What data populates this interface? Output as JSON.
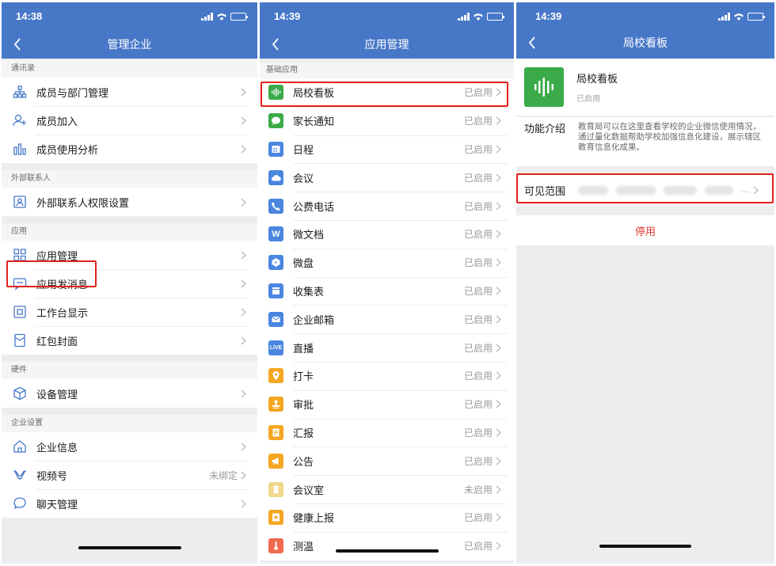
{
  "colors": {
    "header": "#4778c8",
    "highlight": "#e2211c",
    "danger": "#e53935"
  },
  "panel1": {
    "time": "14:38",
    "title": "管理企业",
    "sections": [
      {
        "title": "通讯录",
        "items": [
          {
            "label": "成员与部门管理",
            "icon": "org-chart-icon"
          },
          {
            "label": "成员加入",
            "icon": "user-add-icon"
          },
          {
            "label": "成员使用分析",
            "icon": "bar-chart-icon"
          }
        ]
      },
      {
        "title": "外部联系人",
        "items": [
          {
            "label": "外部联系人权限设置",
            "icon": "contact-card-icon"
          }
        ]
      },
      {
        "title": "应用",
        "items": [
          {
            "label": "应用管理",
            "icon": "grid-icon"
          },
          {
            "label": "应用发消息",
            "icon": "message-icon"
          },
          {
            "label": "工作台显示",
            "icon": "workbench-icon"
          },
          {
            "label": "红包封面",
            "icon": "red-packet-icon"
          }
        ]
      },
      {
        "title": "硬件",
        "items": [
          {
            "label": "设备管理",
            "icon": "cube-icon"
          }
        ]
      },
      {
        "title": "企业设置",
        "items": [
          {
            "label": "企业信息",
            "icon": "home-icon"
          },
          {
            "label": "视频号",
            "icon": "video-channel-icon",
            "value": "未绑定"
          },
          {
            "label": "聊天管理",
            "icon": "chat-icon"
          }
        ]
      }
    ]
  },
  "panel2": {
    "time": "14:39",
    "title": "应用管理",
    "section_title": "基础应用",
    "apps": [
      {
        "label": "局校看板",
        "status": "已启用",
        "icon": "sound-wave-icon",
        "color": "#3bab4a"
      },
      {
        "label": "家长通知",
        "status": "已启用",
        "icon": "chat-bubble-icon",
        "color": "#3bab4a"
      },
      {
        "label": "日程",
        "status": "已启用",
        "icon": "calendar-icon",
        "color": "#4a86e0"
      },
      {
        "label": "会议",
        "status": "已启用",
        "icon": "cloud-meeting-icon",
        "color": "#4a86e0"
      },
      {
        "label": "公费电话",
        "status": "已启用",
        "icon": "phone-icon",
        "color": "#4a86e0"
      },
      {
        "label": "微文档",
        "status": "已启用",
        "icon": "w-doc-icon",
        "color": "#4a86e0",
        "glyph": "W"
      },
      {
        "label": "微盘",
        "status": "已启用",
        "icon": "drive-icon",
        "color": "#4a86e0"
      },
      {
        "label": "收集表",
        "status": "已启用",
        "icon": "form-icon",
        "color": "#4a86e0"
      },
      {
        "label": "企业邮箱",
        "status": "已启用",
        "icon": "mail-icon",
        "color": "#4a86e0"
      },
      {
        "label": "直播",
        "status": "已启用",
        "icon": "live-icon",
        "color": "#4a86e0",
        "glyph": "LIVE"
      },
      {
        "label": "打卡",
        "status": "已启用",
        "icon": "location-pin-icon",
        "color": "#f5a623"
      },
      {
        "label": "审批",
        "status": "已启用",
        "icon": "stamp-icon",
        "color": "#f5a623"
      },
      {
        "label": "汇报",
        "status": "已启用",
        "icon": "report-icon",
        "color": "#f5a623"
      },
      {
        "label": "公告",
        "status": "已启用",
        "icon": "megaphone-icon",
        "color": "#f5a623"
      },
      {
        "label": "会议室",
        "status": "未启用",
        "icon": "door-icon",
        "color": "#f3d78a"
      },
      {
        "label": "健康上报",
        "status": "已启用",
        "icon": "health-icon",
        "color": "#f5a623"
      },
      {
        "label": "测温",
        "status": "已启用",
        "icon": "thermometer-icon",
        "color": "#f06a4f"
      }
    ]
  },
  "panel3": {
    "time": "14:39",
    "title": "局校看板",
    "app_name": "局校看板",
    "app_status": "已启用",
    "intro_label": "功能介绍",
    "intro_text": "教育局可以在这里查看学校的企业微信使用情况，通过量化数据帮助学校加强信息化建设，展示辖区教育信息化成果。",
    "scope_label": "可见范围",
    "scope_tail": "…",
    "disable_label": "停用"
  }
}
